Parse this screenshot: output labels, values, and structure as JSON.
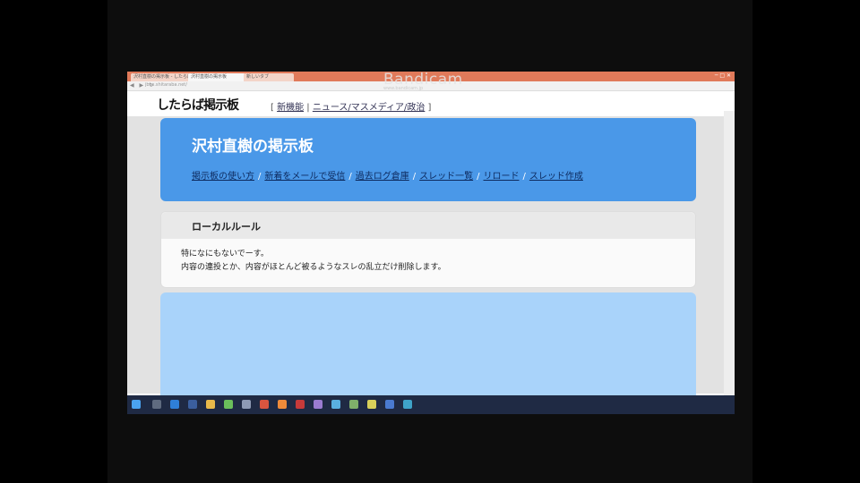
{
  "browser": {
    "tabs": [
      {
        "label": "沢村直樹の掲示板 - したらば掲示板",
        "active": false
      },
      {
        "label": "沢村直樹の掲示板",
        "active": true
      },
      {
        "label": "新しいタブ",
        "active": false
      }
    ],
    "window_controls": "─ □ ✕",
    "url": "jbbs.shitaraba.net/",
    "nav_glyphs": "◀ ▶ ↻"
  },
  "site": {
    "logo": "したらば掲示板",
    "top_links": [
      "新機能",
      "ニュース/マスメディア/政治"
    ]
  },
  "board": {
    "title": "沢村直樹の掲示板",
    "nav": [
      "掲示板の使い方",
      "新着をメールで受信",
      "過去ログ倉庫",
      "スレッド一覧",
      "リロード",
      "スレッド作成"
    ]
  },
  "local_rules": {
    "heading": "ローカルルール",
    "lines": [
      "特になにもないでーす。",
      "内容の連投とか、内容がほとんど被るようなスレの乱立だけ削除します。"
    ]
  },
  "overlay": {
    "watermark": "Bandicam",
    "watermark_sub": "www.bandicam.jp"
  },
  "colors": {
    "header_bg": "#4a98e8",
    "panel_bg": "#a9d3fa",
    "tabbar_bg": "#e07a5a",
    "taskbar_bg": "#1f2a44"
  }
}
